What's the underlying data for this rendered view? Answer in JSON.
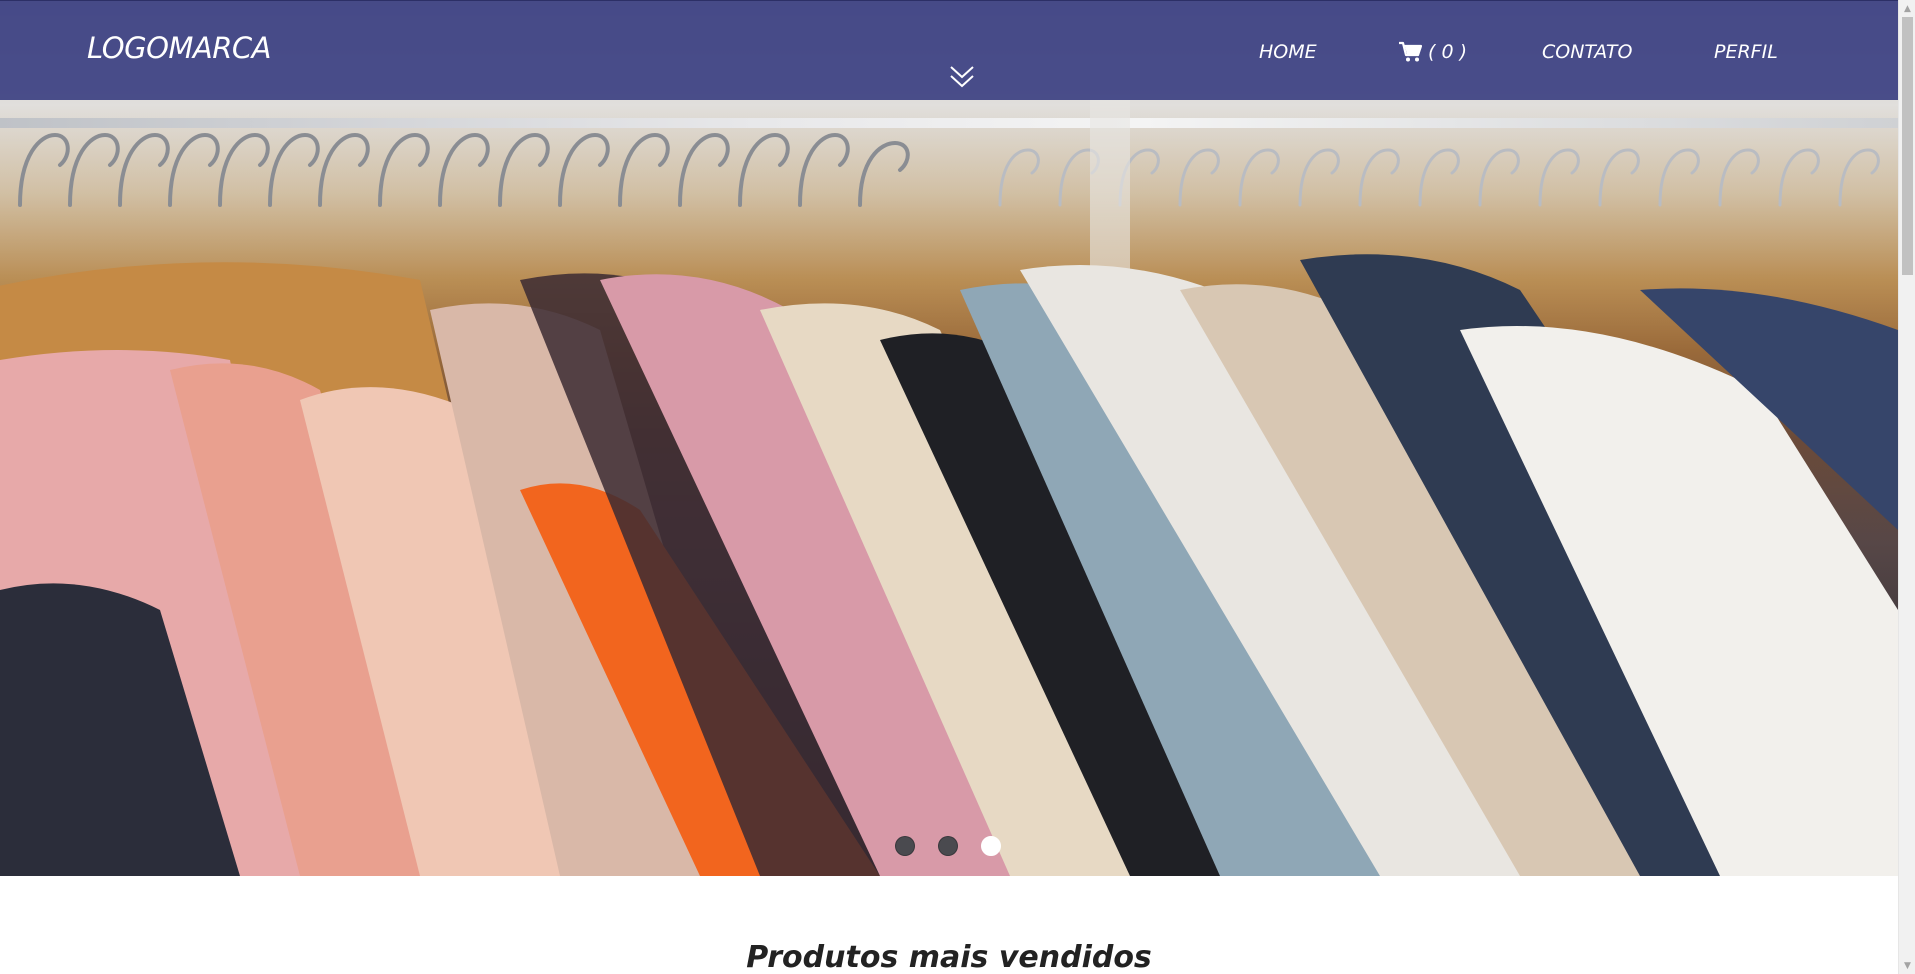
{
  "header": {
    "logo": "LOGOMARCA",
    "nav": {
      "home": "HOME",
      "cart_count": "( 0 )",
      "contato": "CONTATO",
      "perfil": "PERFIL"
    }
  },
  "carousel": {
    "slide_count": 3,
    "active_index": 2,
    "image": "rack of clothes on wooden hangers"
  },
  "main": {
    "section_title": "Produtos mais vendidos"
  },
  "icons": {
    "cart": "cart-icon",
    "scroll_down": "chevron-down-icon"
  },
  "colors": {
    "header_bg": "#3c4082",
    "text": "#ffffff",
    "dot_active": "#ffffff",
    "dot_inactive": "#4a4a4f"
  }
}
